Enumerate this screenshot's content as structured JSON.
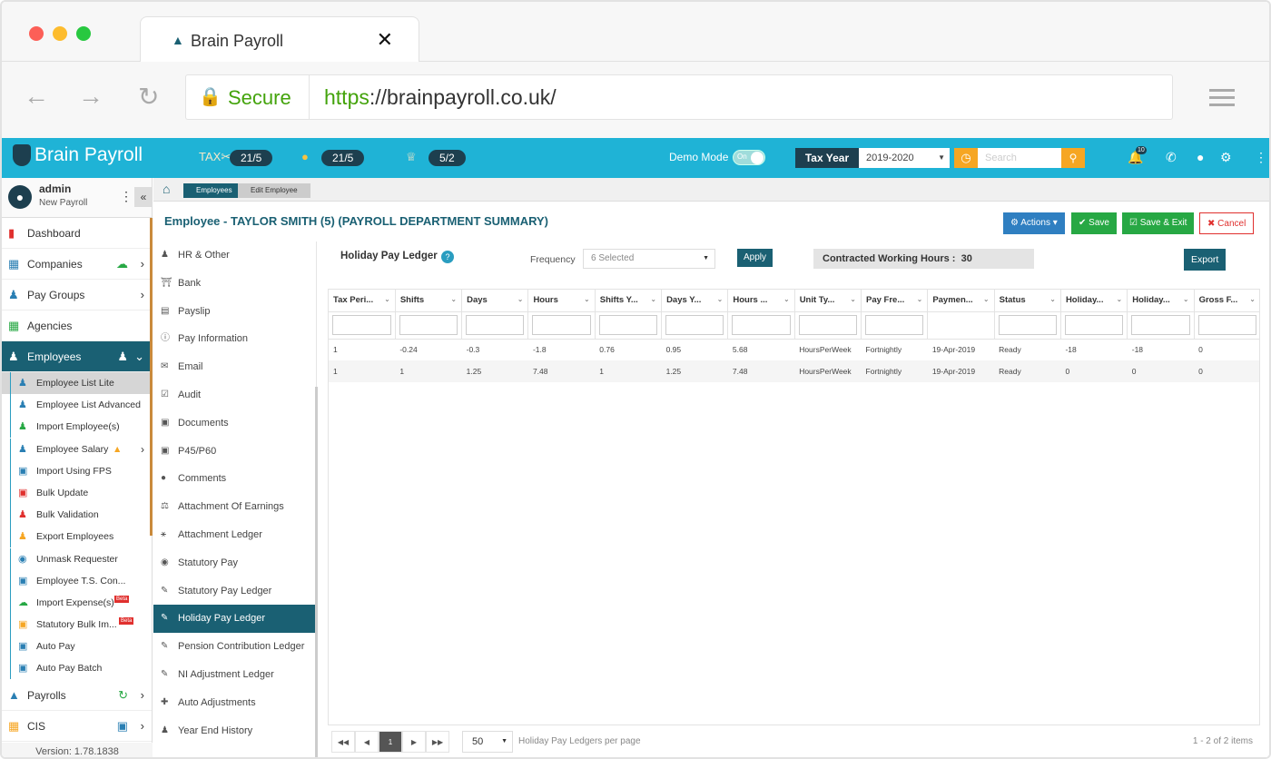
{
  "browser": {
    "tab_title": "Brain Payroll",
    "secure_label": "Secure",
    "url_scheme": "https",
    "url_rest": "://brainpayroll.co.uk/"
  },
  "topbar": {
    "logo_text": "Brain Payroll",
    "counters": [
      "21/5",
      "21/5",
      "5/2"
    ],
    "demo_label": "Demo Mode",
    "toggle_state": "On",
    "tax_year_label": "Tax Year",
    "tax_year_value": "2019-2020",
    "search_placeholder": "Search",
    "notification_count": "10"
  },
  "user": {
    "name": "admin",
    "subtitle": "New Payroll"
  },
  "nav": {
    "items": [
      {
        "label": "Dashboard"
      },
      {
        "label": "Companies"
      },
      {
        "label": "Pay Groups"
      },
      {
        "label": "Agencies"
      },
      {
        "label": "Employees"
      }
    ],
    "sub_items": [
      {
        "label": "Employee List Lite"
      },
      {
        "label": "Employee List Advanced"
      },
      {
        "label": "Import Employee(s)"
      },
      {
        "label": "Employee Salary"
      },
      {
        "label": "Import Using FPS"
      },
      {
        "label": "Bulk Update"
      },
      {
        "label": "Bulk Validation"
      },
      {
        "label": "Export Employees"
      },
      {
        "label": "Unmask Requester"
      },
      {
        "label": "Employee T.S. Con..."
      },
      {
        "label": "Import Expense(s)"
      },
      {
        "label": "Statutory Bulk Im..."
      },
      {
        "label": "Auto Pay"
      },
      {
        "label": "Auto Pay Batch"
      }
    ],
    "beta_label": "Beta",
    "bottom_items": [
      {
        "label": "Payrolls"
      },
      {
        "label": "CIS"
      }
    ],
    "version": "Version: 1.78.1838"
  },
  "breadcrumb": {
    "items": [
      "Employees",
      "Edit Employee"
    ]
  },
  "page": {
    "title": "Employee - TAYLOR SMITH (5) (PAYROLL DEPARTMENT SUMMARY)",
    "actions_label": "Actions",
    "save_label": "Save",
    "save_exit_label": "Save & Exit",
    "cancel_label": "Cancel"
  },
  "subnav": {
    "items": [
      {
        "label": "HR & Other"
      },
      {
        "label": "Bank"
      },
      {
        "label": "Payslip"
      },
      {
        "label": "Pay Information"
      },
      {
        "label": "Email"
      },
      {
        "label": "Audit"
      },
      {
        "label": "Documents"
      },
      {
        "label": "P45/P60"
      },
      {
        "label": "Comments"
      },
      {
        "label": "Attachment Of Earnings"
      },
      {
        "label": "Attachment Ledger"
      },
      {
        "label": "Statutory Pay"
      },
      {
        "label": "Statutory Pay Ledger"
      },
      {
        "label": "Holiday Pay Ledger"
      },
      {
        "label": "Pension Contribution Ledger"
      },
      {
        "label": "NI Adjustment Ledger"
      },
      {
        "label": "Auto Adjustments"
      },
      {
        "label": "Year End History"
      }
    ]
  },
  "ledger": {
    "title": "Holiday Pay Ledger",
    "frequency_label": "Frequency",
    "frequency_value": "6 Selected",
    "apply_label": "Apply",
    "contracted_label": "Contracted Working Hours :",
    "contracted_value": "30",
    "export_label": "Export",
    "columns": [
      "Tax Peri...",
      "Shifts",
      "Days",
      "Hours",
      "Shifts Y...",
      "Days Y...",
      "Hours ...",
      "Unit Ty...",
      "Pay Fre...",
      "Paymen...",
      "Status",
      "Holiday...",
      "Holiday...",
      "Gross F..."
    ],
    "rows": [
      [
        "1",
        "-0.24",
        "-0.3",
        "-1.8",
        "0.76",
        "0.95",
        "5.68",
        "HoursPerWeek",
        "Fortnightly",
        "19-Apr-2019",
        "Ready",
        "-18",
        "-18",
        "0"
      ],
      [
        "1",
        "1",
        "1.25",
        "7.48",
        "1",
        "1.25",
        "7.48",
        "HoursPerWeek",
        "Fortnightly",
        "19-Apr-2019",
        "Ready",
        "0",
        "0",
        "0"
      ]
    ],
    "pager": {
      "current_page": "1",
      "page_size": "50",
      "per_page_label": "Holiday Pay Ledgers per page",
      "count_label": "1 - 2 of 2 items"
    }
  }
}
